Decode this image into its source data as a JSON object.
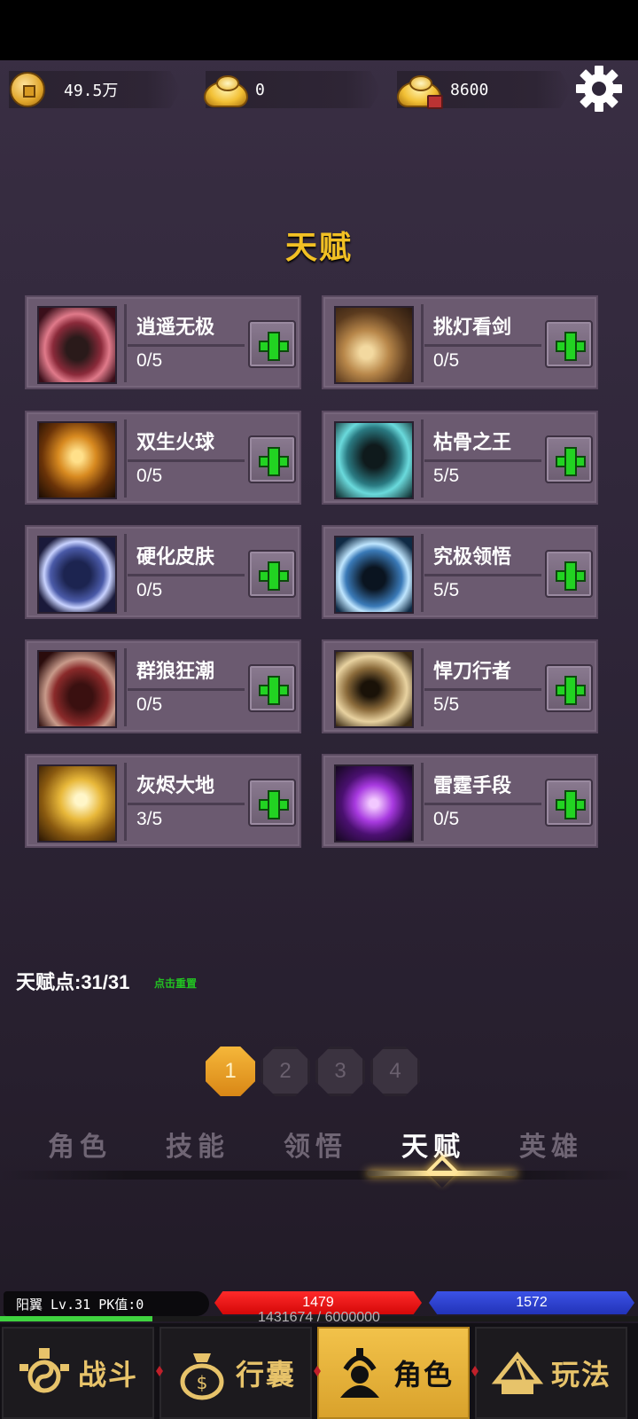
{
  "currency": {
    "coins": {
      "icon": "coin-icon",
      "value": "49.5万"
    },
    "gold_ingot": {
      "icon": "gold-ingot-icon",
      "value": "0"
    },
    "bound_ingot": {
      "icon": "locked-ingot-icon",
      "value": "8600"
    }
  },
  "settings_icon": "gear-icon",
  "title": "天赋",
  "talents": [
    {
      "name": "逍遥无极",
      "level": "0/5",
      "icon": "fan-icon"
    },
    {
      "name": "挑灯看剑",
      "level": "0/5",
      "icon": "sword-slash-icon"
    },
    {
      "name": "双生火球",
      "level": "0/5",
      "icon": "fireball-icon"
    },
    {
      "name": "枯骨之王",
      "level": "5/5",
      "icon": "hooded-king-icon"
    },
    {
      "name": "硬化皮肤",
      "level": "0/5",
      "icon": "armor-shield-icon"
    },
    {
      "name": "究极领悟",
      "level": "5/5",
      "icon": "meditation-icon"
    },
    {
      "name": "群狼狂潮",
      "level": "0/5",
      "icon": "wolf-icon"
    },
    {
      "name": "悍刀行者",
      "level": "5/5",
      "icon": "blade-warrior-icon"
    },
    {
      "name": "灰烬大地",
      "level": "3/5",
      "icon": "fire-strike-icon"
    },
    {
      "name": "雷霆手段",
      "level": "0/5",
      "icon": "thunder-fist-icon"
    }
  ],
  "talent_points": {
    "label": "天赋点:31/31",
    "reset": "点击重置"
  },
  "pages": [
    "1",
    "2",
    "3",
    "4"
  ],
  "active_page": 0,
  "tabs": [
    "角色",
    "技能",
    "领悟",
    "天赋",
    "英雄"
  ],
  "active_tab": 3,
  "player": {
    "info": "阳翼  Lv.31 PK值:0",
    "hp": "1479",
    "mp": "1572",
    "exp_text": "1431674 / 6000000",
    "exp_fraction": 0.2386
  },
  "nav": [
    {
      "label": "战斗",
      "icon": "battle-icon"
    },
    {
      "label": "行囊",
      "icon": "bag-icon"
    },
    {
      "label": "角色",
      "icon": "character-icon"
    },
    {
      "label": "玩法",
      "icon": "gameplay-icon"
    }
  ],
  "active_nav": 2,
  "colors": {
    "accent_gold": "#f2c024",
    "plus_green": "#22d322",
    "hp_red": "#e01010",
    "mp_blue": "#2f47d8"
  }
}
